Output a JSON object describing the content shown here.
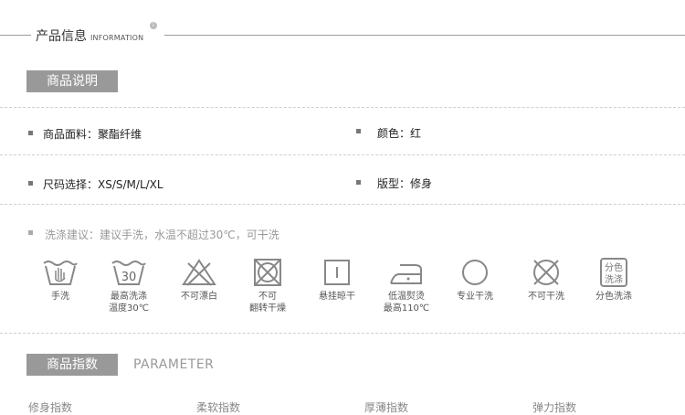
{
  "header": {
    "title": "产品信息",
    "subtitle": "INFORMATION",
    "badge": "i"
  },
  "description_tag": "商品说明",
  "specs": [
    {
      "text": "商品面料：聚酯纤维"
    },
    {
      "text": "颜色：红"
    },
    {
      "text": "尺码选择：XS/S/M/L/XL"
    },
    {
      "text": "版型：修身"
    }
  ],
  "washing_note": "洗涤建议：建议手洗，水温不超过30℃，可干洗",
  "care_icons": [
    {
      "icon": "hand-wash-icon",
      "label": "手洗"
    },
    {
      "icon": "wash-30-icon",
      "label": "最高洗涤\n温度30℃",
      "number": "30"
    },
    {
      "icon": "do-not-bleach-icon",
      "label": "不可漂白"
    },
    {
      "icon": "do-not-tumble-dry-icon",
      "label": "不可\n翻转干燥"
    },
    {
      "icon": "line-dry-icon",
      "label": "悬挂晾干"
    },
    {
      "icon": "low-iron-icon",
      "label": "低温熨烫\n最高110℃"
    },
    {
      "icon": "dry-clean-icon",
      "label": "专业干洗"
    },
    {
      "icon": "do-not-dry-clean-icon",
      "label": "不可干洗"
    },
    {
      "icon": "wash-separately-icon",
      "label": "分色洗涤",
      "icon_text": [
        "分色",
        "洗涤"
      ]
    }
  ],
  "parameter": {
    "tag": "商品指数",
    "english": "PARAMETER"
  },
  "indices": [
    "修身指数",
    "柔软指数",
    "厚薄指数",
    "弹力指数"
  ]
}
